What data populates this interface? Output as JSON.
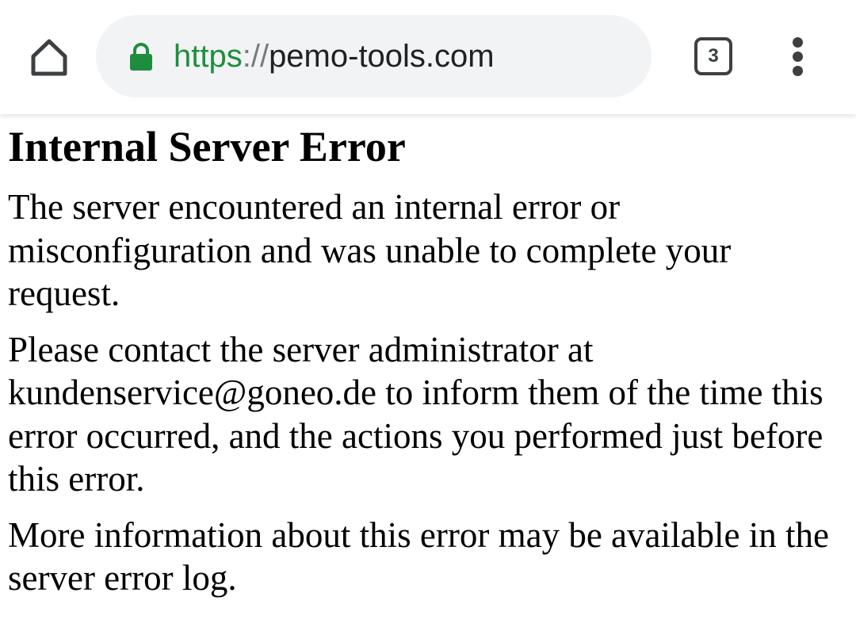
{
  "browser": {
    "address_bar": {
      "scheme": "https",
      "separator": "://",
      "host": "pemo-tools.com"
    },
    "tab_count": "3",
    "icons": {
      "home": "home-icon",
      "lock": "lock-icon",
      "tabs": "tab-switcher-icon",
      "menu": "more-vert-icon"
    },
    "colors": {
      "secure_green": "#1e8e3e",
      "omnibox_bg": "#f1f3f4",
      "icon_gray": "#3c4043"
    }
  },
  "page": {
    "title": "Internal Server Error",
    "paragraph_1": "The server encountered an internal error or misconfiguration and was unable to complete your request.",
    "paragraph_2_before_email": "Please contact the server administrator at ",
    "email": "kundenservice@goneo.de",
    "paragraph_2_after_email": " to inform them of the time this error occurred, and the actions you performed just before this error.",
    "paragraph_3": "More information about this error may be available in the server error log."
  }
}
